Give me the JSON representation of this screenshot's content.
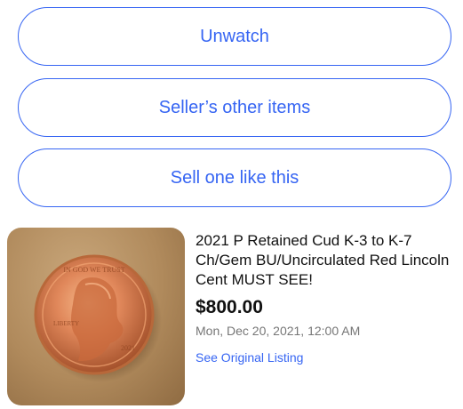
{
  "actions": {
    "unwatch_label": "Unwatch",
    "seller_items_label": "Seller’s other items",
    "sell_like_label": "Sell one like this"
  },
  "listing": {
    "image_icon": "coin-photo",
    "title": "2021 P Retained Cud K-3 to K-7 Ch/Gem BU/Uncirculated Red Lincoln Cent MUST SEE!",
    "price": "$800.00",
    "date": "Mon, Dec 20, 2021, 12:00 AM",
    "link_label": "See Original Listing"
  },
  "colors": {
    "accent": "#3665f3",
    "text": "#111111",
    "muted": "#767676"
  }
}
